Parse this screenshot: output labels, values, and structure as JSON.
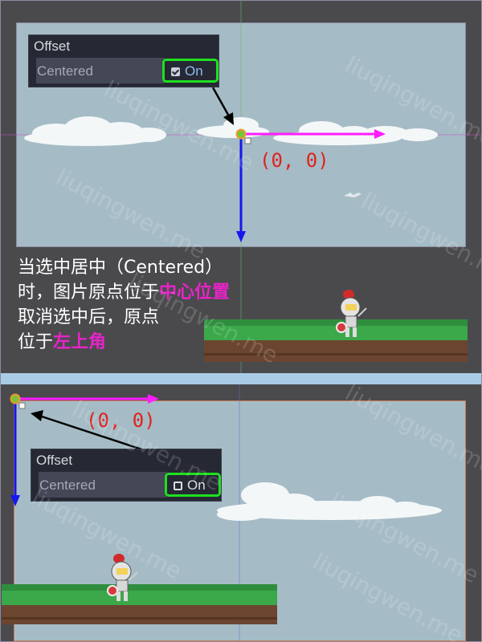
{
  "top": {
    "inspector": {
      "section_title": "Offset",
      "property_label": "Centered",
      "toggle_text": "On",
      "checked": true
    },
    "origin_label": "(0, 0)"
  },
  "caption": {
    "line1": "当选中居中（Centered）",
    "line2_prefix": "时，图片原点位于",
    "line2_highlight": "中心位置",
    "line3": "取消选中后，原点",
    "line4_prefix": "位于",
    "line4_highlight": "左上角"
  },
  "bottom": {
    "inspector": {
      "section_title": "Offset",
      "property_label": "Centered",
      "toggle_text": "On",
      "checked": false
    },
    "origin_label": "(0, 0)"
  },
  "watermark": "liuqingwen.me",
  "colors": {
    "x_axis": "#ff1cff",
    "y_axis": "#1616ee",
    "origin_dot": "#77c43b",
    "toggle_border": "#1fe01f",
    "highlight": "#e923c9",
    "coord_text": "#e0221d",
    "sky": "#a5bcc6",
    "grass": "#3ba84a",
    "ground": "#6b4530"
  }
}
